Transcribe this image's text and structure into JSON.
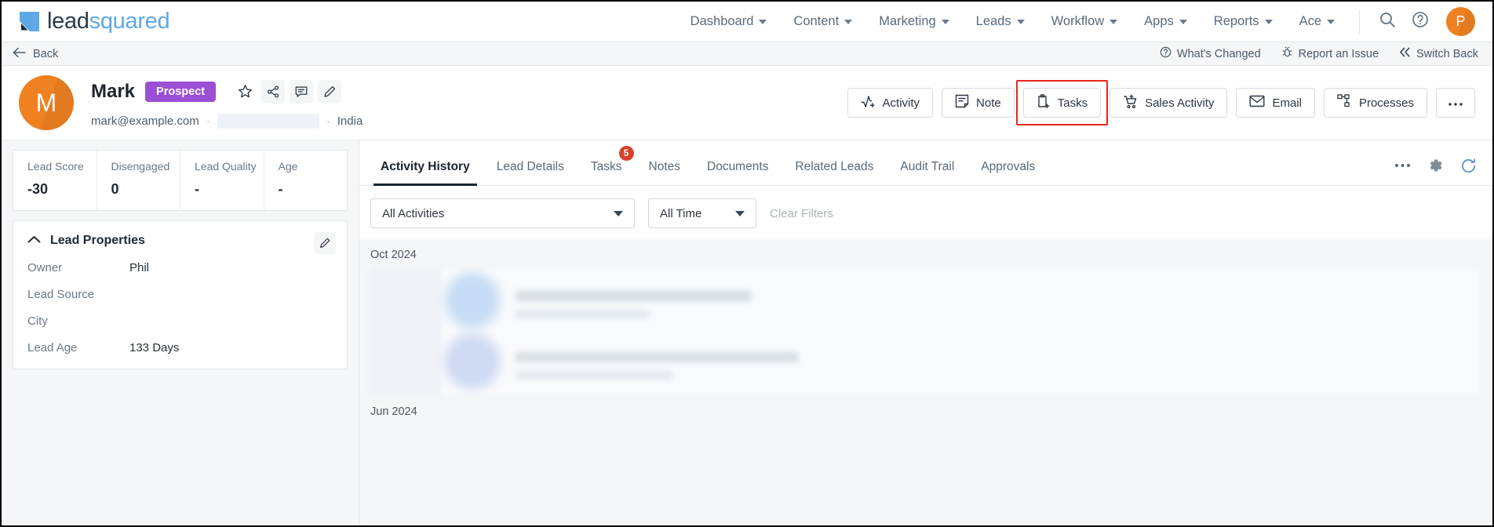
{
  "brand": {
    "name_part1": "lead",
    "name_part2": "squared",
    "logo_icon": "leadsquared-logo-icon",
    "accent_blue": "#5fa8e8",
    "dark": "#2b3a4a",
    "orange": "#ef8121",
    "purple": "#9b4fd4",
    "highlight_red": "#e8261c"
  },
  "topnav": {
    "items": [
      {
        "label": "Dashboard",
        "has_caret": true
      },
      {
        "label": "Content",
        "has_caret": true
      },
      {
        "label": "Marketing",
        "has_caret": true
      },
      {
        "label": "Leads",
        "has_caret": true
      },
      {
        "label": "Workflow",
        "has_caret": true
      },
      {
        "label": "Apps",
        "has_caret": true
      },
      {
        "label": "Reports",
        "has_caret": true
      },
      {
        "label": "Ace",
        "has_caret": true
      }
    ],
    "search_icon": "search-icon",
    "help_icon": "help-circle-icon",
    "avatar_initial": "P"
  },
  "subbar": {
    "back_label": "Back",
    "back_icon": "arrow-left-icon",
    "links": [
      {
        "label": "What's Changed",
        "icon": "help-circle-icon"
      },
      {
        "label": "Report an Issue",
        "icon": "bug-icon"
      },
      {
        "label": "Switch Back",
        "icon": "chevron-double-left-icon"
      }
    ]
  },
  "lead": {
    "avatar_initial": "M",
    "name": "Mark",
    "stage_badge": "Prospect",
    "email": "mark@example.com",
    "country": "India",
    "mini_actions": [
      {
        "name": "star-icon"
      },
      {
        "name": "share-icon"
      },
      {
        "name": "comment-icon"
      },
      {
        "name": "edit-pencil-icon"
      }
    ]
  },
  "action_buttons": [
    {
      "label": "Activity",
      "icon": "activity-add-icon",
      "highlighted": false
    },
    {
      "label": "Note",
      "icon": "note-icon",
      "highlighted": false
    },
    {
      "label": "Tasks",
      "icon": "clipboard-add-icon",
      "highlighted": true
    },
    {
      "label": "Sales Activity",
      "icon": "cart-add-icon",
      "highlighted": false
    },
    {
      "label": "Email",
      "icon": "envelope-icon",
      "highlighted": false
    },
    {
      "label": "Processes",
      "icon": "process-nodes-icon",
      "highlighted": false
    },
    {
      "label": "",
      "icon": "more-horizontal-icon",
      "highlighted": false
    }
  ],
  "metrics": [
    {
      "label": "Lead Score",
      "value": "-30"
    },
    {
      "label": "Disengaged",
      "value": "0"
    },
    {
      "label": "Lead Quality",
      "value": "-"
    },
    {
      "label": "Age",
      "value": "-"
    }
  ],
  "lead_properties": {
    "title": "Lead Properties",
    "collapse_icon": "chevron-up-icon",
    "edit_icon": "edit-pencil-icon",
    "rows": [
      {
        "key": "Owner",
        "value": "Phil"
      },
      {
        "key": "Lead Source",
        "value": ""
      },
      {
        "key": "City",
        "value": ""
      },
      {
        "key": "Lead Age",
        "value": "133 Days"
      }
    ]
  },
  "tabs": [
    {
      "label": "Activity History",
      "active": true,
      "badge": ""
    },
    {
      "label": "Lead Details",
      "active": false,
      "badge": ""
    },
    {
      "label": "Tasks",
      "active": false,
      "badge": "5"
    },
    {
      "label": "Notes",
      "active": false,
      "badge": ""
    },
    {
      "label": "Documents",
      "active": false,
      "badge": ""
    },
    {
      "label": "Related Leads",
      "active": false,
      "badge": ""
    },
    {
      "label": "Audit Trail",
      "active": false,
      "badge": ""
    },
    {
      "label": "Approvals",
      "active": false,
      "badge": ""
    }
  ],
  "tab_tools": [
    {
      "name": "more-horizontal-icon"
    },
    {
      "name": "gear-icon"
    },
    {
      "name": "refresh-icon"
    }
  ],
  "filters": {
    "activity_type": "All Activities",
    "time_range": "All Time",
    "clear_label": "Clear Filters"
  },
  "activity_feed": {
    "month_1": "Oct 2024",
    "month_2": "Jun 2024"
  }
}
